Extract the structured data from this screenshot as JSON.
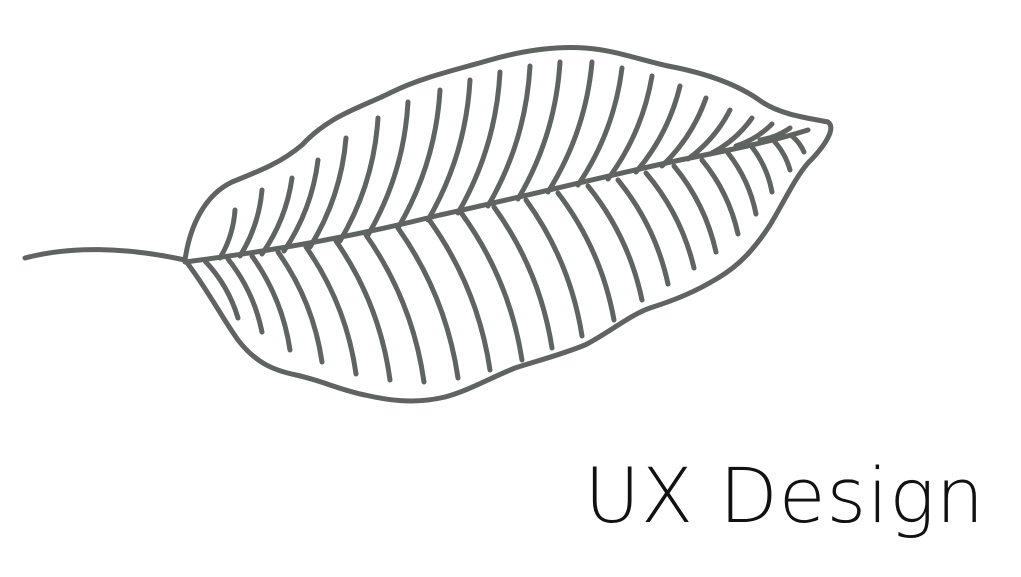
{
  "illustration": {
    "icon": "leaf-icon",
    "stroke_color": "#5f6461"
  },
  "caption": {
    "text": "UX Design",
    "color": "#111111"
  }
}
